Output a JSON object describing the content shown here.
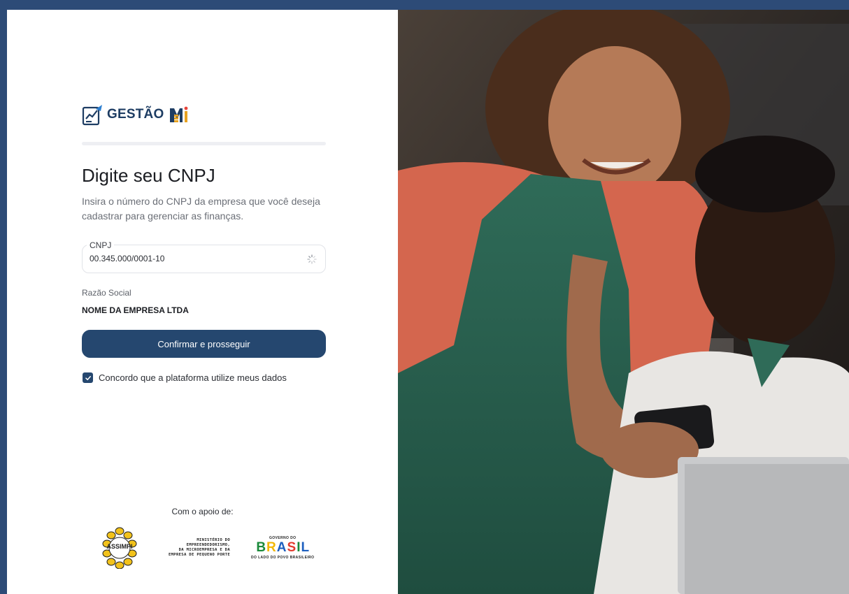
{
  "brand": {
    "name": "GESTÃO",
    "mark": "MEI"
  },
  "form": {
    "title": "Digite seu CNPJ",
    "subtitle": "Insira o número do CNPJ da empresa que você deseja cadastrar para gerenciar as finanças.",
    "cnpj_label": "CNPJ",
    "cnpj_value": "00.345.000/0001-10",
    "razao_label": "Razão Social",
    "razao_value": "NOME DA EMPRESA LTDA",
    "submit_label": "Confirmar e prosseguir",
    "agree_label": "Concordo que a plataforma utilize meus dados",
    "agree_checked": true
  },
  "support": {
    "label": "Com o apoio de:",
    "assimpi": "ASSIMPI",
    "ministerio_lines": [
      "MINISTÉRIO DO",
      "EMPREENDEDORISMO,",
      "DA MICROEMPRESA E DA",
      "EMPRESA DE PEQUENO PORTE"
    ],
    "gov_top": "GOVERNO DO",
    "gov_word": "BRASIL",
    "gov_bottom": "DO LADO DO POVO BRASILEIRO"
  },
  "colors": {
    "primary": "#25476f",
    "frame": "#2d4b77",
    "title": "#1b1d22",
    "muted": "#6b6f77"
  },
  "icons": [
    "report-chart-icon",
    "loading-spinner-icon",
    "check-icon"
  ]
}
